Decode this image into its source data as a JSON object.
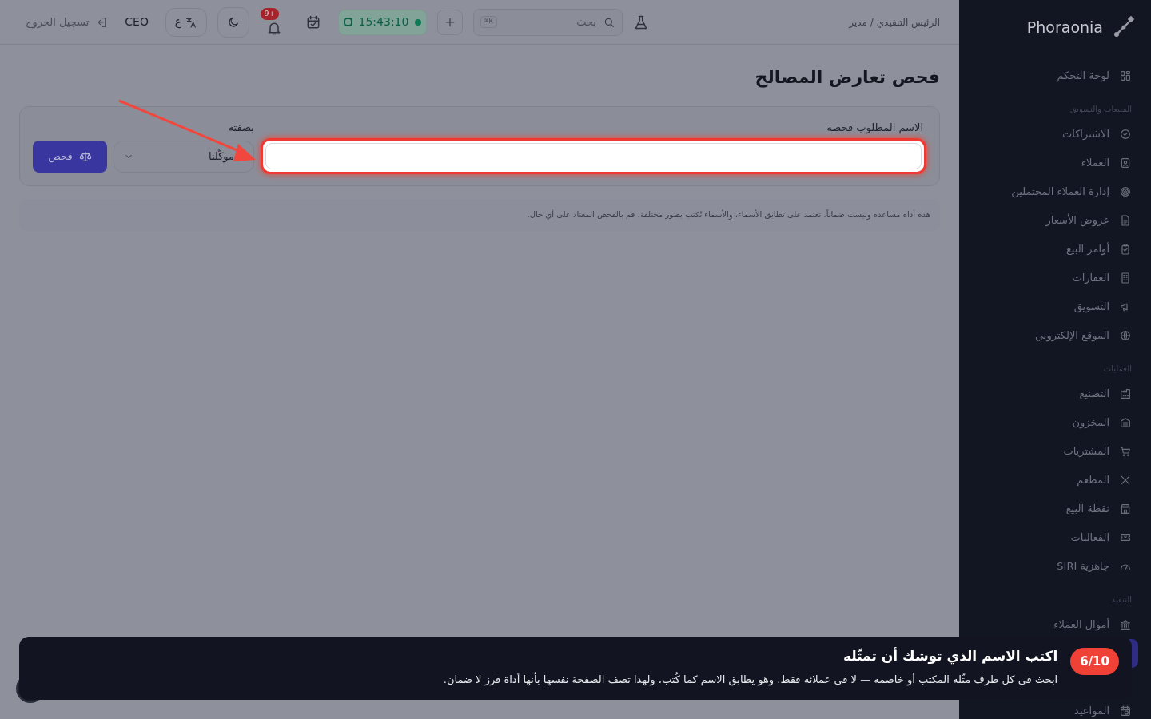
{
  "sidebar": {
    "brand": "Phoraonia",
    "sections": [
      {
        "items": [
          {
            "label": "لوحة التحكم",
            "selected": false
          }
        ]
      },
      {
        "heading": "المبيعات والتسويق",
        "items": [
          {
            "label": "الاشتراكات",
            "selected": false
          },
          {
            "label": "العملاء",
            "selected": false
          },
          {
            "label": "إدارة العملاء المحتملين",
            "selected": false
          },
          {
            "label": "عروض الأسعار",
            "selected": false
          },
          {
            "label": "أوامر البيع",
            "selected": false
          },
          {
            "label": "العقارات",
            "selected": false
          },
          {
            "label": "التسويق",
            "selected": false
          },
          {
            "label": "الموقع الإلكتروني",
            "selected": false
          }
        ]
      },
      {
        "heading": "العمليات",
        "items": [
          {
            "label": "التصنيع",
            "selected": false
          },
          {
            "label": "المخزون",
            "selected": false
          },
          {
            "label": "المشتريات",
            "selected": false
          },
          {
            "label": "المطعم",
            "selected": false
          },
          {
            "label": "نقطة البيع",
            "selected": false
          },
          {
            "label": "الفعاليات",
            "selected": false
          },
          {
            "label": "جاهزية SIRI",
            "selected": false
          }
        ]
      },
      {
        "heading": "التنفيذ",
        "items": [
          {
            "label": "أموال العملاء",
            "selected": false
          },
          {
            "selected": true
          },
          {
            "label": "المواعيد",
            "selected": false
          }
        ]
      }
    ]
  },
  "header": {
    "breadcrumb": "الرئيس التنفيذي / مدير",
    "search": {
      "placeholder": "بحث",
      "shortcut": "K⌘"
    },
    "timer": "15:43:10",
    "notifications_badge": "+9",
    "language": "ع",
    "role": "CEO",
    "logout": "تسجيل الخروج"
  },
  "page": {
    "title": "فحص تعارض المصالح",
    "form": {
      "name_label": "الاسم المطلوب فحصه",
      "capacity_label": "بصفته",
      "capacity_value": "موكّلنا",
      "check_button": "فحص"
    },
    "note": "هذه أداة مساعدة وليست ضماناً. تعتمد على تطابق الأسماء، والأسماء تُكتب بصور مختلفة. قم بالفحص المعتاد على أي حال."
  },
  "tour": {
    "step": "6/10",
    "title": "اكتب الاسم الذي توشك أن تمثّله",
    "body": "ابحث في كل طرف مثّله المكتب أو خاصمه — لا في عملائه فقط. وهو يطابق الاسم كما كُتب، ولهذا تصف الصفحة نفسها بأنها أداة فرز لا ضمان."
  }
}
